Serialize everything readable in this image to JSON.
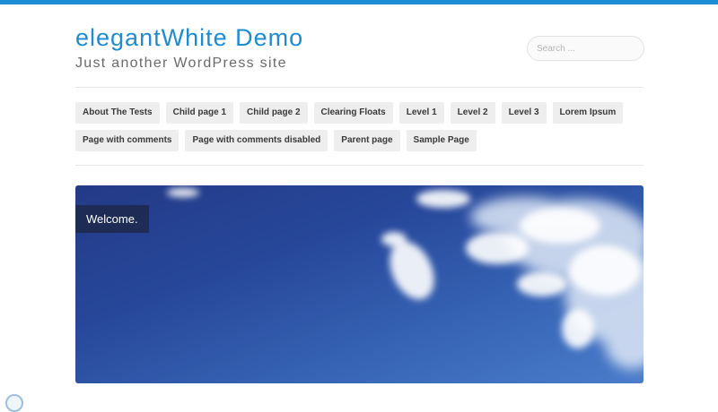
{
  "header": {
    "site_title": "elegantWhite Demo",
    "tagline": "Just another WordPress site",
    "search_placeholder": "Search ..."
  },
  "colors": {
    "accent": "#1e8cd2",
    "nav_bg": "#eeeeee",
    "hero_sky": "#27479a"
  },
  "nav": {
    "row1": [
      {
        "label": "About The Tests"
      },
      {
        "label": "Child page 1"
      },
      {
        "label": "Child page 2"
      },
      {
        "label": "Clearing Floats"
      },
      {
        "label": "Level 1"
      },
      {
        "label": "Level 2"
      },
      {
        "label": "Level 3"
      },
      {
        "label": "Lorem Ipsum"
      }
    ],
    "row2": [
      {
        "label": "Page with comments"
      },
      {
        "label": "Page with comments disabled"
      },
      {
        "label": "Parent page"
      },
      {
        "label": "Sample Page"
      }
    ]
  },
  "hero": {
    "caption": "Welcome."
  }
}
